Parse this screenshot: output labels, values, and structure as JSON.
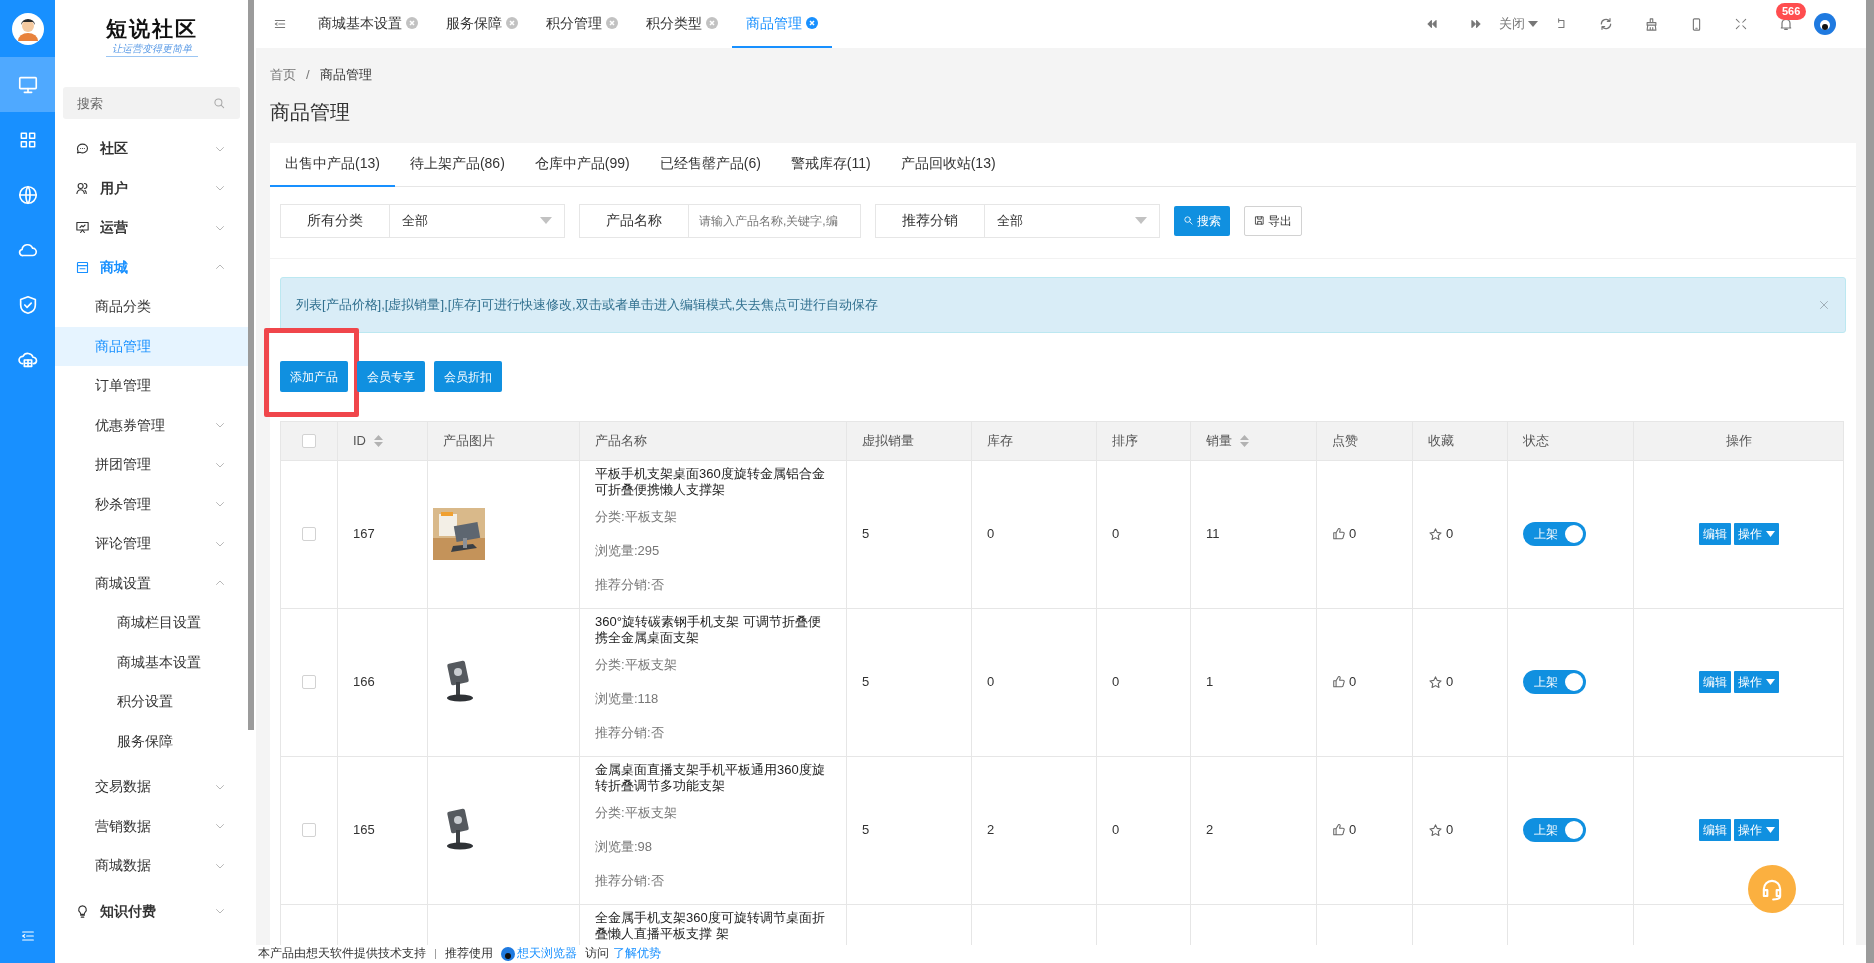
{
  "rail": [
    {
      "selected": true
    },
    {
      "selected": false
    },
    {
      "selected": false
    },
    {
      "selected": false
    },
    {
      "selected": false
    },
    {
      "selected": false
    }
  ],
  "brand": {
    "name": "短说社区",
    "slogan": "让运营变得更简单"
  },
  "sidebar": {
    "search": {
      "placeholder": "搜索"
    },
    "items": [
      {
        "label": "社区",
        "expanded": false
      },
      {
        "label": "用户",
        "expanded": false
      },
      {
        "label": "运营",
        "expanded": false
      },
      {
        "label": "商城",
        "expanded": true,
        "children": [
          {
            "label": "商品分类",
            "selected": false
          },
          {
            "label": "商品管理",
            "selected": true
          },
          {
            "label": "订单管理",
            "selected": false
          },
          {
            "label": "优惠券管理",
            "selected": false,
            "expanded": false
          },
          {
            "label": "拼团管理",
            "selected": false,
            "expanded": false
          },
          {
            "label": "秒杀管理",
            "selected": false,
            "expanded": false
          },
          {
            "label": "评论管理",
            "selected": false,
            "expanded": false
          },
          {
            "label": "商城设置",
            "selected": false,
            "expanded": true,
            "children": [
              {
                "label": "商城栏目设置",
                "selected": false
              },
              {
                "label": "商城基本设置",
                "selected": false
              },
              {
                "label": "积分设置",
                "selected": false
              },
              {
                "label": "服务保障",
                "selected": false
              }
            ]
          },
          {
            "label": "交易数据",
            "selected": false,
            "expanded": false
          },
          {
            "label": "营销数据",
            "selected": false,
            "expanded": false
          },
          {
            "label": "商城数据",
            "selected": false,
            "expanded": false
          }
        ]
      },
      {
        "label": "知识付费",
        "expanded": false
      }
    ]
  },
  "page_tabs": [
    {
      "label": "商城基本设置",
      "selected": false
    },
    {
      "label": "服务保障",
      "selected": false
    },
    {
      "label": "积分管理",
      "selected": false
    },
    {
      "label": "积分类型",
      "selected": false
    },
    {
      "label": "商品管理",
      "selected": true
    }
  ],
  "toolbar": {
    "close_menu": "关闭",
    "notifications": "566"
  },
  "breadcrumb": [
    "首页",
    "/",
    "商品管理"
  ],
  "title": "商品管理",
  "tabs": [
    {
      "label": "出售中产品(13)",
      "selected": true
    },
    {
      "label": "待上架产品(86)",
      "selected": false
    },
    {
      "label": "仓库中产品(99)",
      "selected": false
    },
    {
      "label": "已经售罄产品(6)",
      "selected": false
    },
    {
      "label": "警戒库存(11)",
      "selected": false
    },
    {
      "label": "产品回收站(13)",
      "selected": false
    }
  ],
  "filters": [
    {
      "kind": "select",
      "label": "所有分类",
      "value": "全部"
    },
    {
      "kind": "input",
      "label": "产品名称",
      "placeholder": "请输入产品名称,关键字,编"
    },
    {
      "kind": "select",
      "label": "推荐分销",
      "value": "全部"
    }
  ],
  "filter_buttons": [
    {
      "kind": "search",
      "label": "搜索"
    },
    {
      "kind": "export",
      "label": "导出"
    }
  ],
  "notice": "列表[产品价格],[虚拟销量],[库存]可进行快速修改,双击或者单击进入编辑模式,失去焦点可进行自动保存",
  "actions": [
    {
      "label": "添加产品",
      "highlighted": true
    },
    {
      "label": "会员专享",
      "highlighted": false
    },
    {
      "label": "会员折扣",
      "highlighted": false
    }
  ],
  "table": {
    "header_checked": false,
    "columns": [
      {
        "label": "ID",
        "sortable": true
      },
      {
        "label": "产品图片",
        "sortable": false
      },
      {
        "label": "产品名称",
        "sortable": false
      },
      {
        "label": "虚拟销量",
        "sortable": false
      },
      {
        "label": "库存",
        "sortable": false
      },
      {
        "label": "排序",
        "sortable": false
      },
      {
        "label": "销量",
        "sortable": true
      },
      {
        "label": "点赞",
        "sortable": false
      },
      {
        "label": "收藏",
        "sortable": false
      },
      {
        "label": "状态",
        "sortable": false
      },
      {
        "label": "操作",
        "sortable": false
      }
    ],
    "rows": [
      {
        "checked": false,
        "id": "167",
        "name": "平板手机支架桌面360度旋转金属铝合金可折叠便携懒人支撑架",
        "category": "分类:平板支架",
        "views": "浏览量:295",
        "recommend": "推荐分销:否",
        "virtual_sales": "5",
        "stock": "0",
        "sort": "0",
        "sales": "11",
        "likes": "0",
        "favorites": "0",
        "status": {
          "label": "上架",
          "on": true
        },
        "edit": "编辑",
        "more": "操作"
      },
      {
        "checked": false,
        "id": "166",
        "name": "360°旋转碳素钢手机支架 可调节折叠便携全金属桌面支架",
        "category": "分类:平板支架",
        "views": "浏览量:118",
        "recommend": "推荐分销:否",
        "virtual_sales": "5",
        "stock": "0",
        "sort": "0",
        "sales": "1",
        "likes": "0",
        "favorites": "0",
        "status": {
          "label": "上架",
          "on": true
        },
        "edit": "编辑",
        "more": "操作"
      },
      {
        "checked": false,
        "id": "165",
        "name": "金属桌面直播支架手机平板通用360度旋转折叠调节多功能支架",
        "category": "分类:平板支架",
        "views": "浏览量:98",
        "recommend": "推荐分销:否",
        "virtual_sales": "5",
        "stock": "2",
        "sort": "0",
        "sales": "2",
        "likes": "0",
        "favorites": "0",
        "status": {
          "label": "上架",
          "on": true
        },
        "edit": "编辑",
        "more": "操作"
      },
      {
        "name": "全金属手机支架360度可旋转调节桌面折叠懒人直播平板支撑 架"
      }
    ]
  },
  "footer": {
    "support": "本产品由想天软件提供技术支持",
    "separator": "|",
    "recommend": "推荐使用",
    "browser_link": "想天浏览器",
    "visit": "访问",
    "advantage_link": "了解优势"
  }
}
